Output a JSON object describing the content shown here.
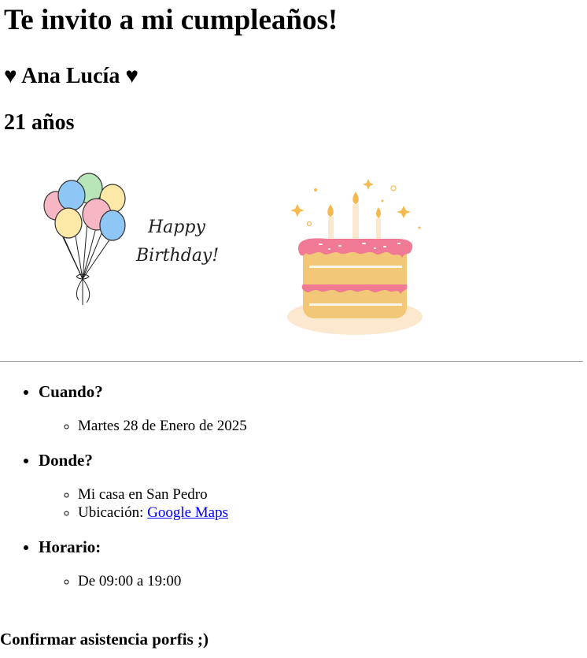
{
  "header": {
    "title": "Te invito a mi cumpleaños!",
    "name": "♥ Ana Lucía ♥",
    "age": "21 años"
  },
  "images": {
    "left_text_line1": "Happy",
    "left_text_line2": "Birthday!",
    "balloon_colors": [
      "#f7b6c3",
      "#8ec6f6",
      "#b8e6b8",
      "#fce9a8",
      "#f7b6c3",
      "#8ec6f6",
      "#fce9a8"
    ],
    "cake_colors": {
      "frosting": "#f07a93",
      "sponge": "#f2c777",
      "plate": "#fbe8cf",
      "flame": "#f5b950"
    }
  },
  "details": {
    "when": {
      "label": "Cuando?",
      "items": [
        "Martes 28 de Enero de 2025"
      ]
    },
    "where": {
      "label": "Donde?",
      "items": [
        "Mi casa en San Pedro"
      ],
      "location_prefix": "Ubicación: ",
      "map_link_label": "Google Maps"
    },
    "schedule": {
      "label": "Horario:",
      "items": [
        "De 09:00 a 19:00"
      ]
    }
  },
  "confirm": "Confirmar asistencia porfis ;)"
}
